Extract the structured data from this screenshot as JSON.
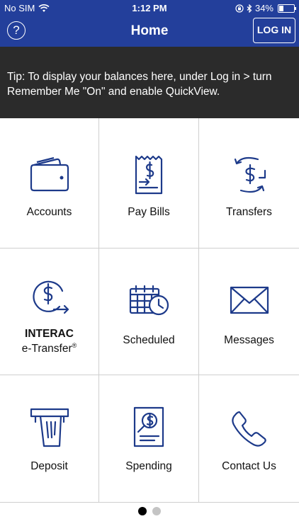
{
  "status_bar": {
    "carrier": "No SIM",
    "time": "1:12 PM",
    "battery": "34%",
    "battery_level": 0.34
  },
  "header": {
    "help": "?",
    "title": "Home",
    "login": "LOG IN"
  },
  "tip": "Tip: To display your balances here, under Log in > turn Remember Me \"On\" and enable QuickView.",
  "tiles": [
    {
      "label": "Accounts",
      "icon": "wallet-icon"
    },
    {
      "label": "Pay Bills",
      "icon": "bill-icon"
    },
    {
      "label": "Transfers",
      "icon": "transfer-icon"
    },
    {
      "label1": "INTERAC",
      "label2": "e-Transfer",
      "reg": "®",
      "icon": "etransfer-icon"
    },
    {
      "label": "Scheduled",
      "icon": "calendar-clock-icon"
    },
    {
      "label": "Messages",
      "icon": "envelope-icon"
    },
    {
      "label": "Deposit",
      "icon": "atm-deposit-icon"
    },
    {
      "label": "Spending",
      "icon": "spending-report-icon"
    },
    {
      "label": "Contact Us",
      "icon": "phone-icon"
    }
  ],
  "colors": {
    "brand": "#233f9b",
    "icon": "#1d3a8a",
    "tip_bg": "#2b2b2b",
    "dot_active": "#000000",
    "dot_inactive": "#c4c4c4"
  }
}
